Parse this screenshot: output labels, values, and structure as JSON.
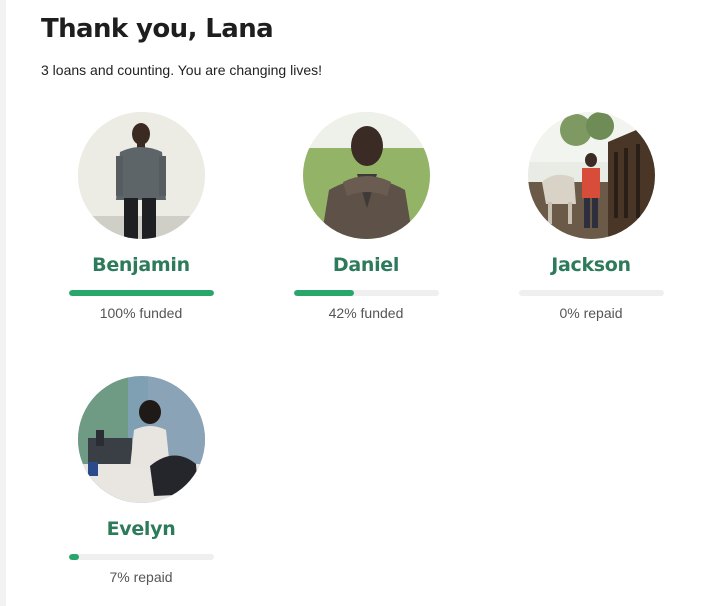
{
  "header": {
    "title": "Thank you, Lana",
    "subtitle": "3 loans and counting. You are changing lives!"
  },
  "colors": {
    "name_green": "#2e7b5b",
    "progress_fill": "#29a66a",
    "progress_track": "#efefef"
  },
  "loans": [
    {
      "name": "Benjamin",
      "status": "100% funded",
      "progress": 1.0
    },
    {
      "name": "Daniel",
      "status": "42% funded",
      "progress": 0.42
    },
    {
      "name": "Jackson",
      "status": "0% repaid",
      "progress": 0.0
    },
    {
      "name": "Evelyn",
      "status": "7% repaid",
      "progress": 0.07
    }
  ]
}
